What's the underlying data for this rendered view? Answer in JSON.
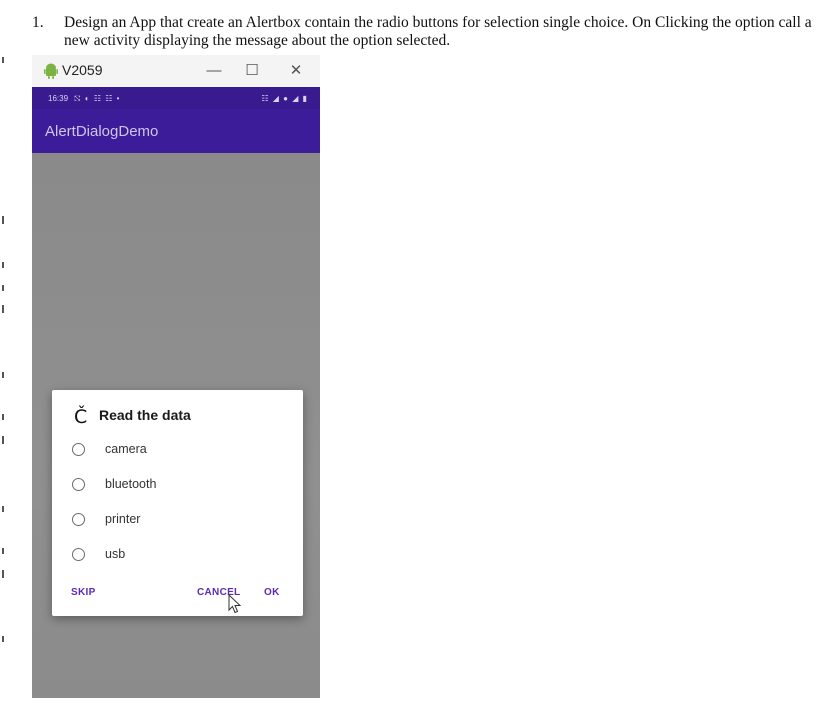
{
  "question": {
    "number": "1.",
    "text": "Design an App that create an Alertbox contain the radio buttons for selection single choice. On Clicking the option call a new activity displaying the message about the option selected."
  },
  "emulator": {
    "window_title": "V2059",
    "status_time": "16:39",
    "status_notifications": "⛞ ◐ ☷ ☷ •",
    "status_system": "☷ ◢ ● ◢ ▮",
    "app_title": "AlertDialogDemo",
    "dialog": {
      "icon_glyph": "Č",
      "title": "Read the data",
      "options": [
        "camera",
        "bluetooth",
        "printer",
        "usb"
      ],
      "buttons": {
        "skip": "SKIP",
        "cancel": "CANCEL",
        "ok": "OK"
      }
    }
  },
  "colors": {
    "appbar": "#3c1c98",
    "statusbar": "#3a1a8f",
    "accent": "#5a2bb5",
    "scrim": "#8c8c8c"
  }
}
